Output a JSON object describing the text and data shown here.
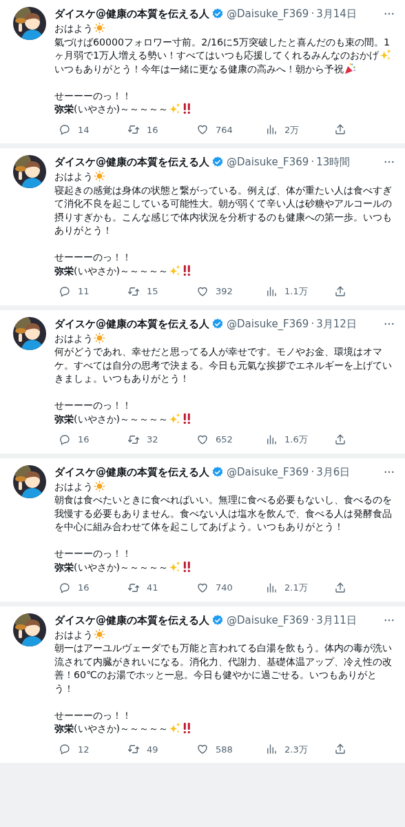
{
  "tweets": [
    {
      "name": "ダイスケ@健康の本質を伝える人",
      "verified": true,
      "handle": "@Daisuke_F369",
      "separator": "·",
      "time": "3月14日",
      "body": [
        [
          {
            "kind": "text",
            "text": "おはよう"
          },
          {
            "kind": "sun"
          }
        ],
        [
          {
            "kind": "text",
            "text": "氣づけば60000フォロワー寸前。2/16に5万突破したと喜んだのも束の間。1ヶ月弱で1万人増える勢い！すべてはいつも応援してくれるみんなのおかげ"
          },
          {
            "kind": "sparkles"
          },
          {
            "kind": "text",
            "text": "いつもありがとう！今年は一緒に更なる健康の高みへ！朝から予祝"
          },
          {
            "kind": "party"
          }
        ]
      ],
      "signoff": [
        [
          {
            "kind": "text",
            "text": "せーーーのっ！！"
          }
        ],
        [
          {
            "kind": "text",
            "text": "**弥栄**(いやさか)～～～～～"
          },
          {
            "kind": "sparkles"
          },
          {
            "kind": "exclaim"
          }
        ]
      ],
      "replies": "14",
      "reposts": "16",
      "likes": "764",
      "views": "2万"
    },
    {
      "name": "ダイスケ@健康の本質を伝える人",
      "verified": true,
      "handle": "@Daisuke_F369",
      "separator": "·",
      "time": "13時間",
      "body": [
        [
          {
            "kind": "text",
            "text": "おはよう"
          },
          {
            "kind": "sun"
          }
        ],
        [
          {
            "kind": "text",
            "text": "寝起きの感覚は身体の状態と繋がっている。例えば、体が重たい人は食べすぎて消化不良を起こしている可能性大。朝が弱くて辛い人は砂糖やアルコールの摂りすぎかも。こんな感じで体内状況を分析するのも健康への第一歩。いつもありがとう！"
          }
        ]
      ],
      "signoff": [
        [
          {
            "kind": "text",
            "text": "せーーーのっ！！"
          }
        ],
        [
          {
            "kind": "text",
            "text": "**弥栄**(いやさか)～～～～～"
          },
          {
            "kind": "sparkles"
          },
          {
            "kind": "exclaim"
          }
        ]
      ],
      "replies": "11",
      "reposts": "15",
      "likes": "392",
      "views": "1.1万"
    },
    {
      "name": "ダイスケ@健康の本質を伝える人",
      "verified": true,
      "handle": "@Daisuke_F369",
      "separator": "·",
      "time": "3月12日",
      "body": [
        [
          {
            "kind": "text",
            "text": "おはよう"
          },
          {
            "kind": "sun"
          }
        ],
        [
          {
            "kind": "text",
            "text": "何がどうであれ、幸せだと思ってる人が幸せです。モノやお金、環境はオマケ。すべては自分の思考で決まる。今日も元氣な挨拶でエネルギーを上げていきましょ。いつもありがとう！"
          }
        ]
      ],
      "signoff": [
        [
          {
            "kind": "text",
            "text": "せーーーのっ！！"
          }
        ],
        [
          {
            "kind": "text",
            "text": "**弥栄**(いやさか)～～～～～"
          },
          {
            "kind": "sparkles"
          },
          {
            "kind": "exclaim"
          }
        ]
      ],
      "replies": "16",
      "reposts": "32",
      "likes": "652",
      "views": "1.6万"
    },
    {
      "name": "ダイスケ@健康の本質を伝える人",
      "verified": true,
      "handle": "@Daisuke_F369",
      "separator": "·",
      "time": "3月6日",
      "body": [
        [
          {
            "kind": "text",
            "text": "おはよう"
          },
          {
            "kind": "sun"
          }
        ],
        [
          {
            "kind": "text",
            "text": "朝食は食べたいときに食べればいい。無理に食べる必要もないし、食べるのを我慢する必要もありません。食べない人は塩水を飲んで、食べる人は発酵食品を中心に組み合わせて体を起こしてあげよう。いつもありがとう！"
          }
        ]
      ],
      "signoff": [
        [
          {
            "kind": "text",
            "text": "せーーーのっ！！"
          }
        ],
        [
          {
            "kind": "text",
            "text": "**弥栄**(いやさか)～～～～～"
          },
          {
            "kind": "sparkles"
          },
          {
            "kind": "exclaim"
          }
        ]
      ],
      "replies": "16",
      "reposts": "41",
      "likes": "740",
      "views": "2.1万"
    },
    {
      "name": "ダイスケ@健康の本質を伝える人",
      "verified": true,
      "handle": "@Daisuke_F369",
      "separator": "·",
      "time": "3月11日",
      "body": [
        [
          {
            "kind": "text",
            "text": "おはよう"
          },
          {
            "kind": "sun"
          }
        ],
        [
          {
            "kind": "text",
            "text": "朝一はアーユルヴェーダでも万能と言われてる白湯を飲もう。体内の毒が洗い流されて内臓がきれいになる。消化力、代謝力、基礎体温アップ、冷え性の改善！60℃のお湯でホッと一息。今日も健やかに過ごせる。いつもありがとう！"
          }
        ]
      ],
      "signoff": [
        [
          {
            "kind": "text",
            "text": "せーーーのっ！！"
          }
        ],
        [
          {
            "kind": "text",
            "text": "**弥栄**(いやさか)～～～～～"
          },
          {
            "kind": "sparkles"
          },
          {
            "kind": "exclaim"
          }
        ]
      ],
      "replies": "12",
      "reposts": "49",
      "likes": "588",
      "views": "2.3万"
    }
  ]
}
